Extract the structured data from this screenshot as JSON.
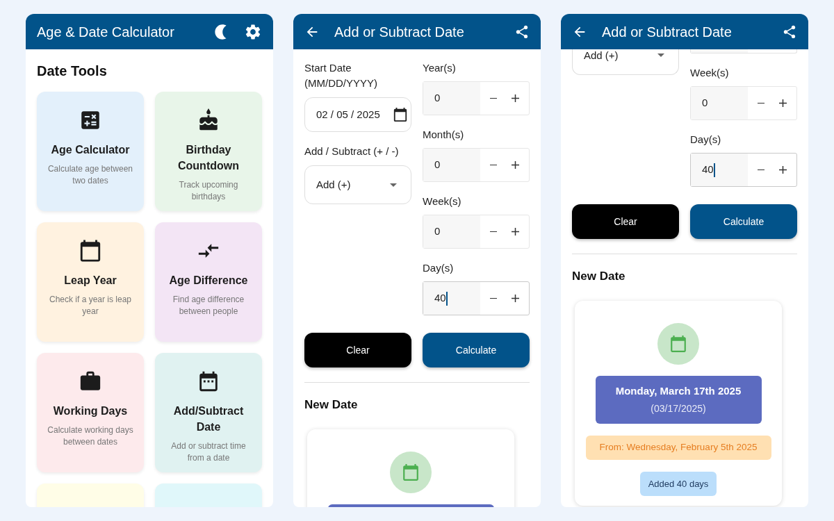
{
  "screens": [
    {
      "kind": "home",
      "title": "Age & Date Calculator",
      "heading": "Date Tools",
      "tools": [
        {
          "title": "Age Calculator",
          "description": "Calculate age between two dates",
          "color": "#e3f0fb"
        },
        {
          "title": "Birthday Countdown",
          "description": "Track upcoming birthdays",
          "color": "#e8f5e9"
        },
        {
          "title": "Leap Year",
          "description": "Check if a year is leap year",
          "color": "#fff2e0"
        },
        {
          "title": "Age Difference",
          "description": "Find age difference between people",
          "color": "#f3e5f5"
        },
        {
          "title": "Working Days",
          "description": "Calculate working days between dates",
          "color": "#fdeaec"
        },
        {
          "title": "Add/Subtract Date",
          "description": "Add or subtract time from a date",
          "color": "#e0f2f1"
        },
        {
          "color": "#fffde7"
        },
        {
          "color": "#e0f7fa"
        }
      ]
    },
    {
      "kind": "form",
      "title": "Add or Subtract Date",
      "left": [
        {
          "kind": "date",
          "label": "Start Date (MM/DD/YYYY)",
          "value": "02 / 05 / 2025"
        },
        {
          "kind": "select",
          "label": "Add / Subtract (+ / -)",
          "value": "Add (+)"
        }
      ],
      "right": [
        {
          "kind": "stepper",
          "label": "Year(s)",
          "value": "0",
          "focused": false
        },
        {
          "kind": "stepper",
          "label": "Month(s)",
          "value": "0",
          "focused": false
        },
        {
          "kind": "stepper",
          "label": "Week(s)",
          "value": "0",
          "focused": false
        },
        {
          "kind": "stepper",
          "label": "Day(s)",
          "value": "40",
          "focused": true
        }
      ],
      "buttons": [
        {
          "label": "Clear",
          "kind": "secondary"
        },
        {
          "label": "Calculate",
          "kind": "primary"
        }
      ],
      "result": {
        "heading": "New Date"
      }
    },
    {
      "kind": "form",
      "title": "Add or Subtract Date",
      "left": [
        {
          "kind": "select_cut",
          "value": "Add (+)"
        }
      ],
      "right": [
        {
          "kind": "stepper_cut"
        },
        {
          "kind": "stepper",
          "label": "Week(s)",
          "value": "0",
          "focused": false
        },
        {
          "kind": "stepper",
          "label": "Day(s)",
          "value": "40",
          "focused": true
        }
      ],
      "buttons": [
        {
          "label": "Clear",
          "kind": "secondary"
        },
        {
          "label": "Calculate",
          "kind": "primary"
        }
      ],
      "result": {
        "heading": "New Date",
        "date": "Monday, March 17th 2025",
        "short_date": "(03/17/2025)",
        "from": "From: Wednesday, February 5th 2025",
        "badge": "Added 40 days"
      }
    }
  ]
}
